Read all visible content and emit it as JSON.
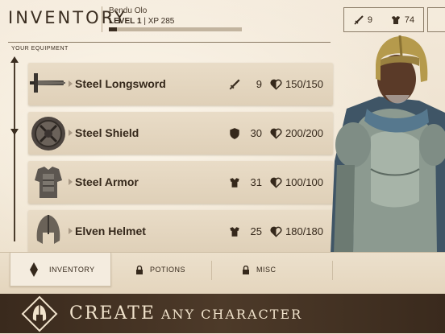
{
  "header": {
    "title": "INVENTORY",
    "character_name": "Bendu Olo",
    "level_label": "LEVEL",
    "level": "1",
    "xp_label": "| XP 285",
    "xp_progress": 0.06
  },
  "stats": {
    "attack_icon": "sword-icon",
    "attack": "9",
    "armor_icon": "armor-icon",
    "armor": "74"
  },
  "equipment": {
    "section_label": "YOUR EQUIPMENT",
    "items": [
      {
        "name": "Steel Longsword",
        "stat_icon": "sword-icon",
        "stat": "9",
        "durability": "150/150"
      },
      {
        "name": "Steel Shield",
        "stat_icon": "shield-icon",
        "stat": "30",
        "durability": "200/200"
      },
      {
        "name": "Steel Armor",
        "stat_icon": "armor-icon",
        "stat": "31",
        "durability": "100/100"
      },
      {
        "name": "Elven Helmet",
        "stat_icon": "armor-icon",
        "stat": "25",
        "durability": "180/180"
      }
    ]
  },
  "tabs": [
    {
      "label": "INVENTORY",
      "icon": "diamond-icon",
      "active": true
    },
    {
      "label": "POTIONS",
      "icon": "lock-icon",
      "active": false
    },
    {
      "label": "MISC",
      "icon": "lock-icon",
      "active": false
    }
  ],
  "banner": {
    "text_big": "CREATE",
    "text_small": "ANY CHARACTER"
  },
  "colors": {
    "ink": "#35281b",
    "parchment": "#efe3d0",
    "banner": "#3a2a1d",
    "banner_text": "#f1e3cc"
  }
}
